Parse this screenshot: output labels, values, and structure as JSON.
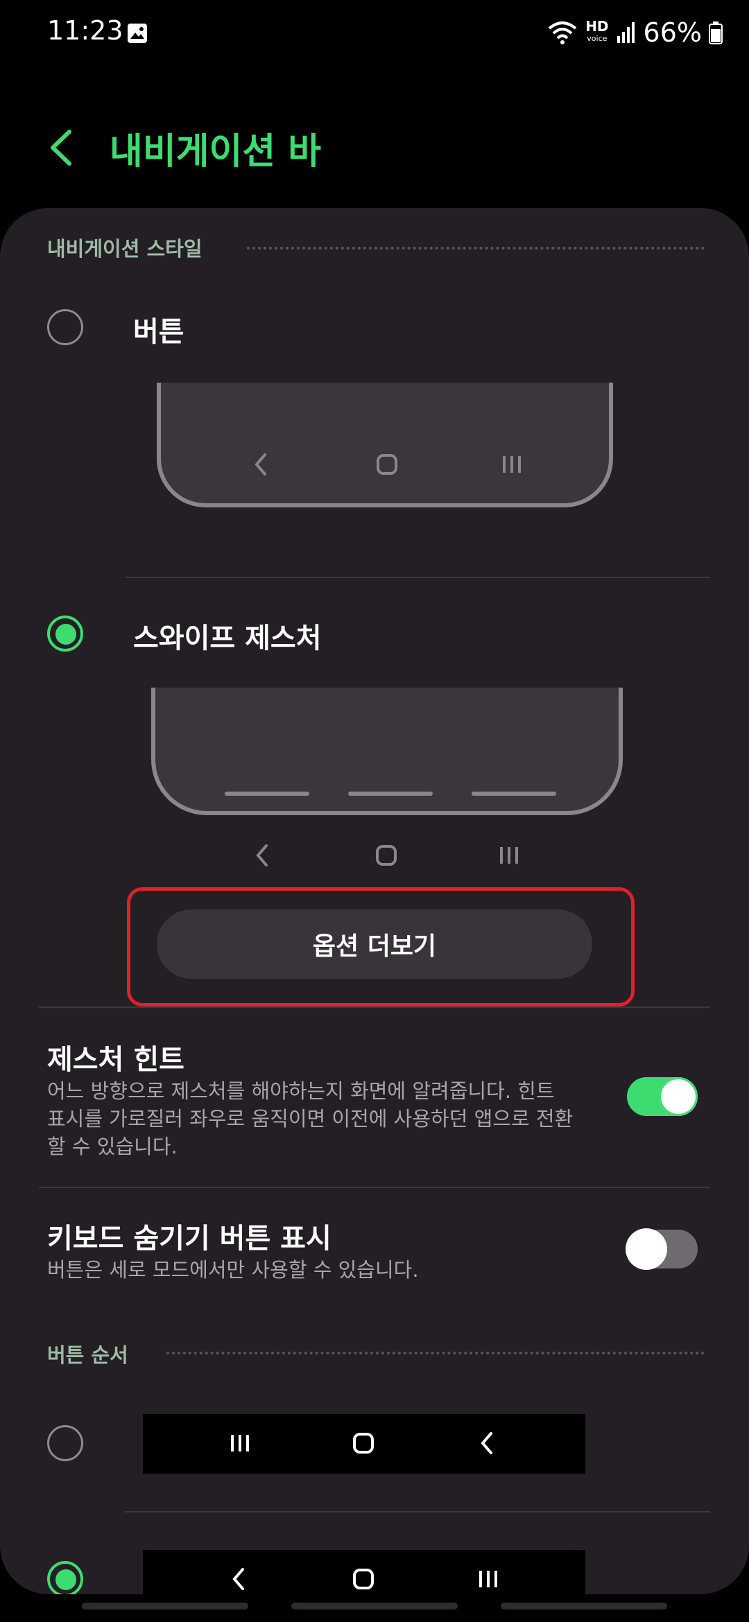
{
  "status_bar": {
    "time": "11:23",
    "hd_label": "HD",
    "voice_label": "voice",
    "battery": "66%",
    "icons": [
      "gallery-icon",
      "wifi-icon",
      "hd-voice-icon",
      "signal-icon",
      "battery-icon"
    ]
  },
  "header": {
    "title": "내비게이션 바",
    "back_icon": "chevron-left-icon"
  },
  "navigation_style": {
    "section_title": "내비게이션 스타일",
    "options": [
      {
        "label": "버튼",
        "selected": false,
        "preview_icons": [
          "back-icon",
          "home-icon",
          "recents-icon"
        ]
      },
      {
        "label": "스와이프 제스처",
        "selected": true,
        "preview_icons": [
          "back-icon",
          "home-icon",
          "recents-icon"
        ]
      }
    ],
    "more_options_label": "옵션 더보기"
  },
  "gesture_hint": {
    "title": "제스처 힌트",
    "description": "어느 방향으로 제스처를 해야하는지 화면에 알려줍니다. 힌트 표시를 가로질러 좌우로 움직이면 이전에 사용하던 앱으로 전환할 수 있습니다.",
    "enabled": true
  },
  "keyboard_hide": {
    "title": "키보드 숨기기 버튼 표시",
    "description": "버튼은 세로 모드에서만 사용할 수 있습니다.",
    "enabled": false
  },
  "button_order": {
    "section_title": "버튼 순서",
    "options": [
      {
        "selected": false,
        "icons": [
          "recents-icon",
          "home-icon",
          "back-icon"
        ]
      },
      {
        "selected": true,
        "icons": [
          "back-icon",
          "home-icon",
          "recents-icon"
        ]
      }
    ]
  },
  "colors": {
    "accent": "#3ddc71",
    "panel_bg": "#231f24",
    "highlight": "#e0202a"
  }
}
